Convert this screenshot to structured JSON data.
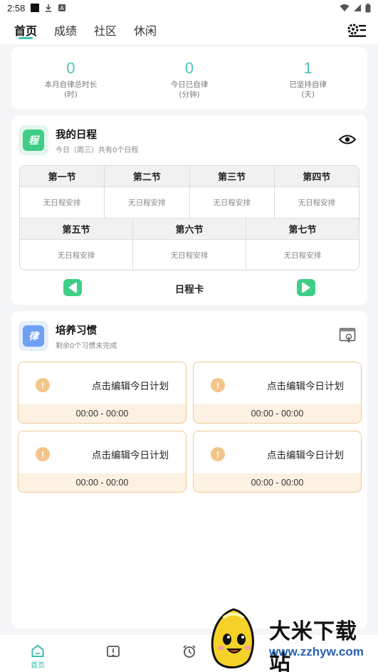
{
  "status_bar": {
    "time": "2:58"
  },
  "top_nav": {
    "tabs": [
      {
        "label": "首页",
        "active": true
      },
      {
        "label": "成绩",
        "active": false
      },
      {
        "label": "社区",
        "active": false
      },
      {
        "label": "休闲",
        "active": false
      }
    ],
    "settings_icon": "settings-gear-icon"
  },
  "stats": [
    {
      "value": "0",
      "label": "本月自律总时长",
      "unit": "(时)"
    },
    {
      "value": "0",
      "label": "今日已自律",
      "unit": "(分钟)"
    },
    {
      "value": "1",
      "label": "已坚持自律",
      "unit": "(天)"
    }
  ],
  "schedule": {
    "icon_char": "程",
    "title": "我的日程",
    "subtitle": "今日（周三）共有0个日程",
    "row1_headers": [
      "第一节",
      "第二节",
      "第三节",
      "第四节"
    ],
    "row1_values": [
      "无日程安排",
      "无日程安排",
      "无日程安排",
      "无日程安排"
    ],
    "row2_headers": [
      "第五节",
      "第六节",
      "第七节"
    ],
    "row2_values": [
      "无日程安排",
      "无日程安排",
      "无日程安排"
    ],
    "nav_label": "日程卡"
  },
  "habit": {
    "icon_char": "律",
    "title": "培养习惯",
    "subtitle": "剩余0个习惯未完成",
    "plans": [
      {
        "text": "点击编辑今日计划",
        "time": "00:00 - 00:00"
      },
      {
        "text": "点击编辑今日计划",
        "time": "00:00 - 00:00"
      },
      {
        "text": "点击编辑今日计划",
        "time": "00:00 - 00:00"
      },
      {
        "text": "点击编辑今日计划",
        "time": "00:00 - 00:00"
      }
    ]
  },
  "bottom_bar": {
    "items": [
      {
        "icon": "home-icon",
        "label": "首页",
        "active": true
      },
      {
        "icon": "book-icon",
        "label": "",
        "active": false
      },
      {
        "icon": "alarm-clock-icon",
        "label": "",
        "active": false
      }
    ]
  },
  "watermark": {
    "text_cn": "大米下载站",
    "text_url": "www.zzhyw.com"
  },
  "colors": {
    "accent": "#3cc4b4",
    "stat_value": "#4fc3bd",
    "schedule_icon": "#3fcd87",
    "habit_icon": "#6d9ff3",
    "plan_border": "#f0c891",
    "plan_footer": "#fdf1e2",
    "warn_icon": "#f4c58a"
  }
}
